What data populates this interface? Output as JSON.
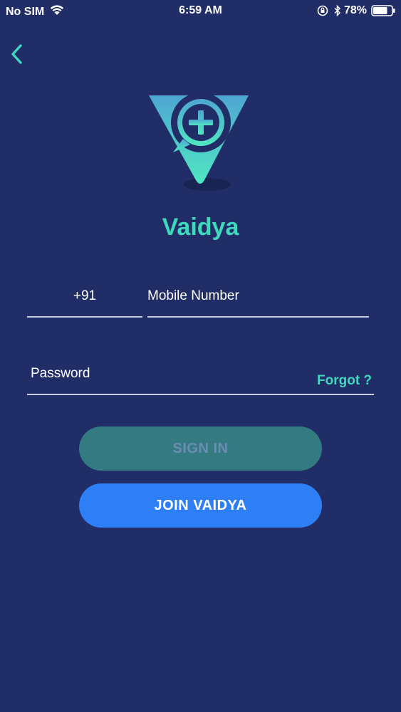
{
  "status_bar": {
    "carrier": "No SIM",
    "time": "6:59 AM",
    "battery": "78%"
  },
  "app": {
    "name": "Vaidya",
    "accent_color": "#3fd8bd",
    "background_color": "#212d66"
  },
  "login_form": {
    "country_code": "+91",
    "mobile_placeholder": "Mobile Number",
    "password_placeholder": "Password",
    "forgot_label": "Forgot ?"
  },
  "buttons": {
    "sign_in_label": "SIGN IN",
    "join_label": "JOIN VAIDYA",
    "join_color": "#2e7ef5"
  }
}
